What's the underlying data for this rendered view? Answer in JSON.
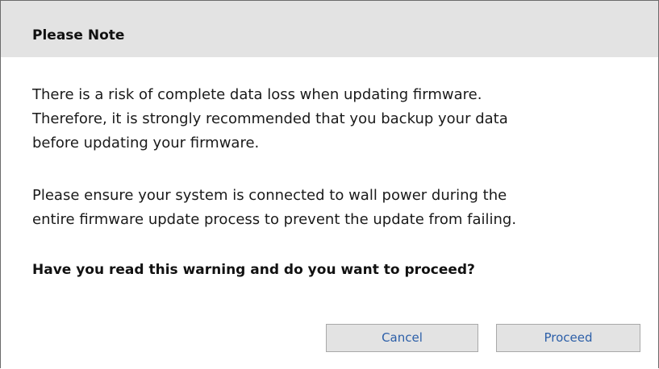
{
  "dialog": {
    "title": "Please Note",
    "paragraph1": [
      "There is a risk of complete data loss when updating firmware.",
      "Therefore, it is strongly recommended that you backup your data",
      "before updating your firmware."
    ],
    "paragraph2": [
      "Please ensure your system is connected to wall power during the",
      "entire firmware update process to prevent the update from failing."
    ],
    "question": "Have you read this warning and do you want to proceed?",
    "buttons": {
      "cancel_label": "Cancel",
      "proceed_label": "Proceed"
    }
  },
  "colors": {
    "header_background": "#e3e3e3",
    "button_background": "#e3e3e3",
    "button_text": "#2c5fa8",
    "border": "#6b6b6b"
  }
}
